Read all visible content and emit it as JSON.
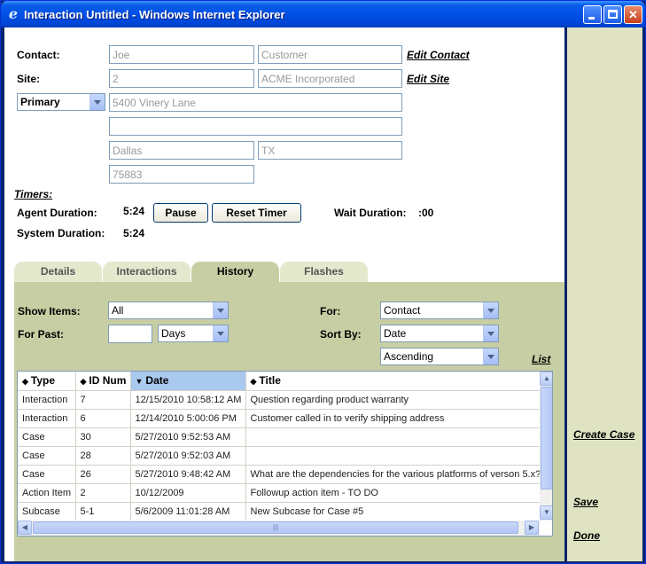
{
  "window": {
    "title": "Interaction Untitled - Windows Internet Explorer"
  },
  "contact": {
    "label": "Contact:",
    "first": "Joe",
    "last": "Customer",
    "edit_link": "Edit Contact"
  },
  "site": {
    "label": "Site:",
    "id": "2",
    "name": "ACME Incorporated",
    "edit_link": "Edit Site"
  },
  "address": {
    "type": "Primary",
    "line1": "5400 Vinery Lane",
    "line2": "",
    "city": "Dallas",
    "state": "TX",
    "zip": "75883"
  },
  "timers": {
    "label": "Timers:",
    "agent_label": "Agent Duration:",
    "agent_value": "5:24",
    "pause_button": "Pause",
    "reset_button": "Reset Timer",
    "wait_label": "Wait Duration:",
    "wait_value": ":00",
    "system_label": "System Duration:",
    "system_value": "5:24"
  },
  "tabs": [
    {
      "label": "Details"
    },
    {
      "label": "Interactions"
    },
    {
      "label": "History",
      "active": true
    },
    {
      "label": "Flashes"
    }
  ],
  "history": {
    "show_items_label": "Show Items:",
    "show_items_value": "All",
    "for_past_label": "For Past:",
    "for_past_amount": "",
    "for_past_unit": "Days",
    "for_label": "For:",
    "for_value": "Contact",
    "sort_by_label": "Sort By:",
    "sort_by_value": "Date",
    "sort_order_value": "Ascending",
    "list_link": "List",
    "columns": [
      "Type",
      "ID Num",
      "Date",
      "Title"
    ],
    "rows": [
      {
        "type": "Interaction",
        "id": "7",
        "date": "12/15/2010 10:58:12 AM",
        "title": "Question regarding product warranty"
      },
      {
        "type": "Interaction",
        "id": "6",
        "date": "12/14/2010 5:00:06 PM",
        "title": "Customer called in to verify shipping address"
      },
      {
        "type": "Case",
        "id": "30",
        "date": "5/27/2010 9:52:53 AM",
        "title": ""
      },
      {
        "type": "Case",
        "id": "28",
        "date": "5/27/2010 9:52:03 AM",
        "title": ""
      },
      {
        "type": "Case",
        "id": "26",
        "date": "5/27/2010 9:48:42 AM",
        "title": "What are the dependencies for the various platforms of verson 5.x?"
      },
      {
        "type": "Action Item",
        "id": "2",
        "date": "10/12/2009",
        "title": "Followup action item - TO DO"
      },
      {
        "type": "Subcase",
        "id": "5-1",
        "date": "5/6/2009 11:01:28 AM",
        "title": "New Subcase for Case #5"
      }
    ]
  },
  "actions": {
    "create_case": "Create Case",
    "save": "Save",
    "done": "Done"
  }
}
